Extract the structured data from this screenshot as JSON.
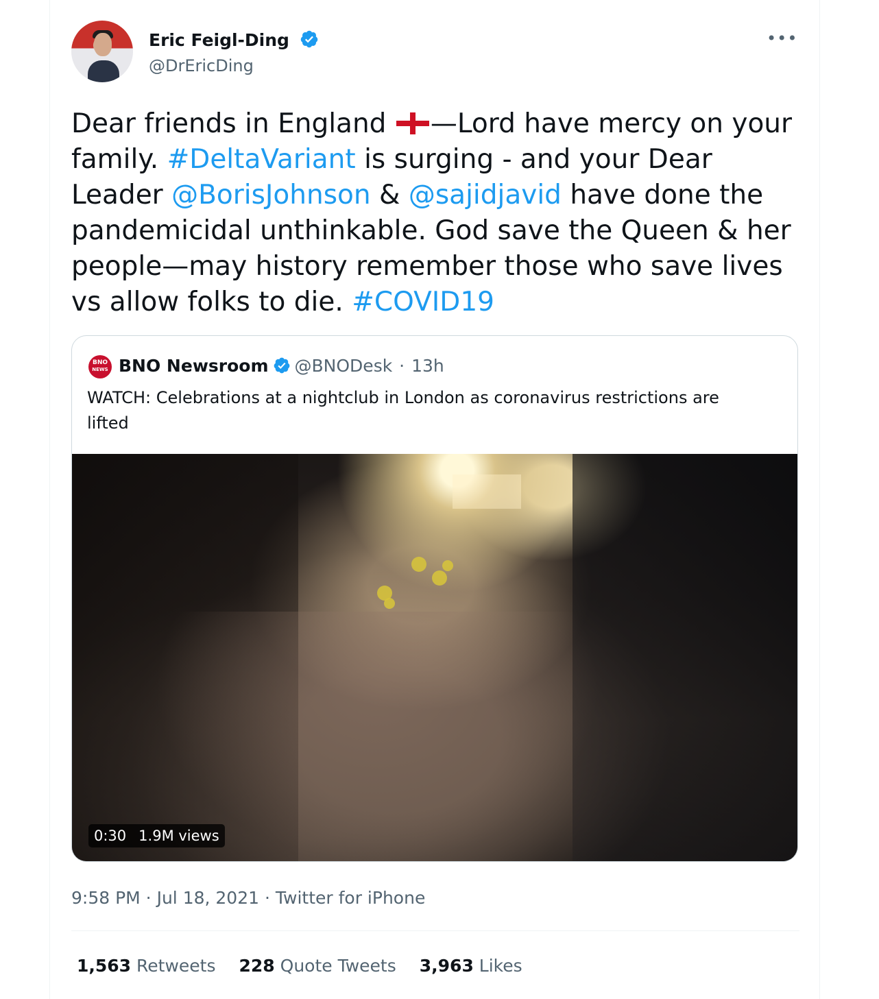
{
  "author": {
    "name": "Eric Feigl-Ding",
    "handle": "@DrEricDing",
    "verified_color": "#1d9bf0"
  },
  "menu_icon": "more-horizontal-icon",
  "tweet": {
    "text_1": "Dear friends in England ",
    "flag_icon": "england-flag-icon",
    "text_2": "—Lord have mercy on your family. ",
    "hashtag_1": "#DeltaVariant",
    "text_3": " is surging - and your Dear Leader ",
    "mention_1": "@BorisJohnson",
    "text_4": " & ",
    "mention_2": "@sajidjavid",
    "text_5": " have done the pandemicidal unthinkable. God save the Queen & her people—may history remember those who save lives vs allow folks to die. ",
    "hashtag_2": "#COVID19",
    "link_color": "#1d9bf0"
  },
  "quoted": {
    "avatar_text_top": "BNO",
    "avatar_text_bottom": "NEWS",
    "name": "BNO Newsroom",
    "handle": "@BNODesk",
    "separator": "·",
    "age": "13h",
    "text": "WATCH: Celebrations at a nightclub in London as coronavirus restrictions are lifted",
    "video": {
      "duration": "0:30",
      "views": "1.9M views"
    }
  },
  "meta": {
    "time": "9:58 PM",
    "date": "Jul 18, 2021",
    "source": "Twitter for iPhone",
    "sep": " · "
  },
  "stats": {
    "retweets_count": "1,563",
    "retweets_label": "Retweets",
    "quotes_count": "228",
    "quotes_label": "Quote Tweets",
    "likes_count": "3,963",
    "likes_label": "Likes"
  }
}
